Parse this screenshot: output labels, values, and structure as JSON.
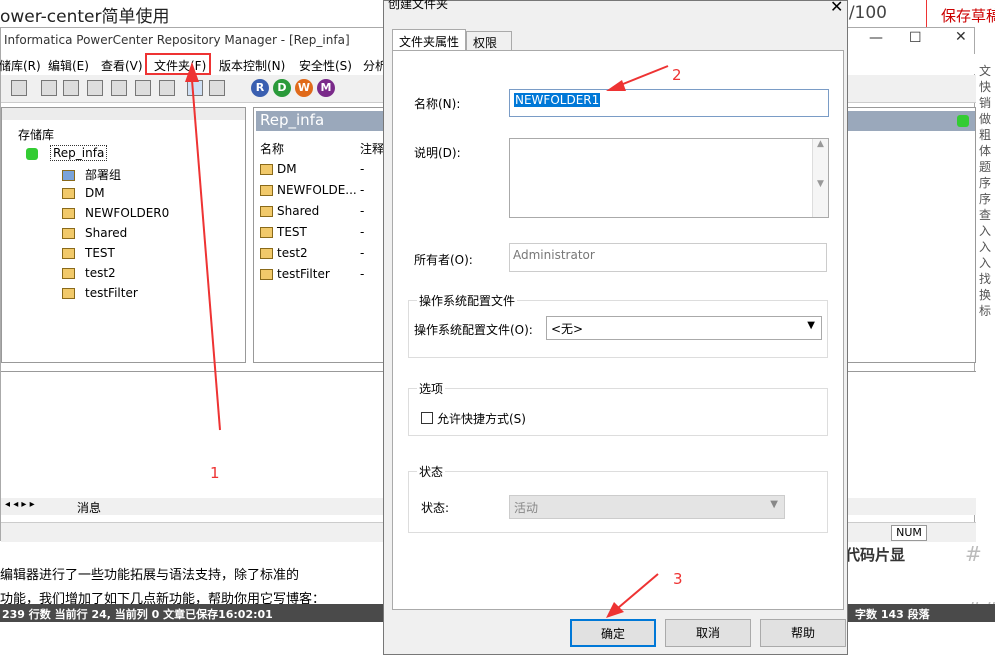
{
  "background": {
    "page_title": "ower-center简单使用",
    "word_count": "6/100",
    "save_draft": "保存草稿",
    "editor_line1": "编辑器进行了一些功能拓展与语法支持，除了标准的",
    "editor_line2": "功能，我们增加了如下几点新功能，帮助你用它写博客：",
    "status_bar": "239 行数   当前行 24, 当前列 0   文章已保存16:02:01",
    "status_right": "字数   143 段落",
    "code_snippet": "代码片显",
    "right_col_text": [
      "文",
      "快",
      "销",
      "做",
      "粗",
      "体",
      "题",
      "序",
      "序",
      "查",
      "入",
      "入",
      "入",
      "找",
      "换",
      "标"
    ]
  },
  "pc": {
    "title": "Informatica PowerCenter Repository Manager - [Rep_infa]",
    "menu": [
      "储库(R)",
      "编辑(E)",
      "查看(V)",
      "文件夹(F)",
      "版本控制(N)",
      "安全性(S)",
      "分析"
    ],
    "tree_root": "存储库",
    "tree_repo": "Rep_infa",
    "tree_items": [
      "部署组",
      "DM",
      "NEWFOLDER0",
      "Shared",
      "TEST",
      "test2",
      "testFilter"
    ],
    "right_header": "Rep_infa",
    "col_name": "名称",
    "col_note": "注释",
    "list": [
      {
        "name": "DM",
        "note": "-"
      },
      {
        "name": "NEWFOLDE...",
        "note": "-"
      },
      {
        "name": "Shared",
        "note": "-"
      },
      {
        "name": "TEST",
        "note": "-"
      },
      {
        "name": "test2",
        "note": "-"
      },
      {
        "name": "testFilter",
        "note": "-"
      }
    ],
    "bottom_tab": "消息",
    "num_indicator": "NUM",
    "toolbar_circles": [
      "R",
      "D",
      "W",
      "M"
    ]
  },
  "dialog": {
    "title": "创建文件夹",
    "tab_props": "文件夹属性",
    "tab_perms": "权限",
    "name_label": "名称(N):",
    "name_value": "NEWFOLDER1",
    "desc_label": "说明(D):",
    "owner_label": "所有者(O):",
    "owner_value": "Administrator",
    "os_group": "操作系统配置文件",
    "os_label": "操作系统配置文件(O):",
    "os_value": "<无>",
    "options_group": "选项",
    "shortcut_label": "允许快捷方式(S)",
    "state_group": "状态",
    "state_label": "状态:",
    "state_value": "活动",
    "ok": "确定",
    "cancel": "取消",
    "help": "帮助"
  },
  "annotations": {
    "n1": "1",
    "n2": "2",
    "n3": "3"
  },
  "colors": {
    "annotation": "#ee3333",
    "selection": "#0078d7",
    "header": "#9aa8bb"
  }
}
